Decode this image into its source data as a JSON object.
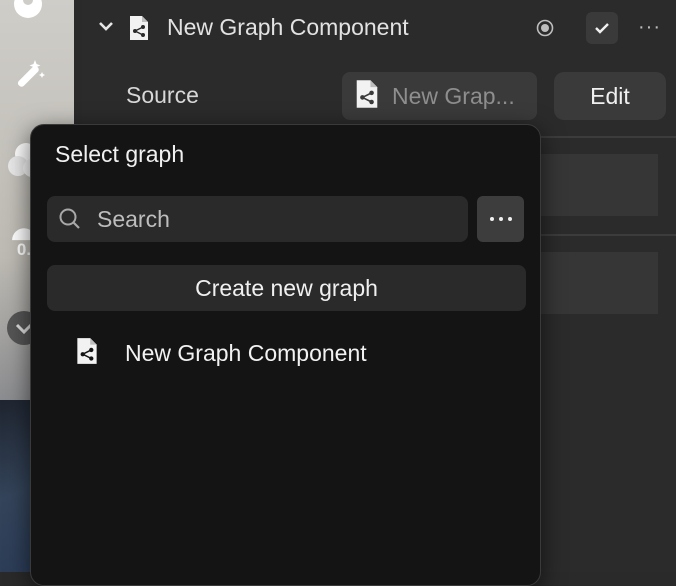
{
  "header": {
    "title": "New Graph Component",
    "collapse_icon": "chevron-down-icon",
    "doc_icon": "graph-document-icon",
    "visibility_icon": "radio-icon",
    "check_icon": "checkmark-icon",
    "more_icon": "ellipsis-icon"
  },
  "source": {
    "label": "Source",
    "value": "New Grap...",
    "edit_label": "Edit"
  },
  "popover": {
    "title": "Select graph",
    "search_placeholder": "Search",
    "create_label": "Create new graph",
    "items": [
      {
        "label": "New Graph Component",
        "icon": "graph-document-icon"
      }
    ]
  },
  "left_toolbar": {
    "partial_label": "0."
  },
  "colors": {
    "popover_bg": "#141414",
    "panel_bg": "#2b2b2b",
    "field_bg": "#3a3a3a",
    "text": "#f0f0f0"
  }
}
